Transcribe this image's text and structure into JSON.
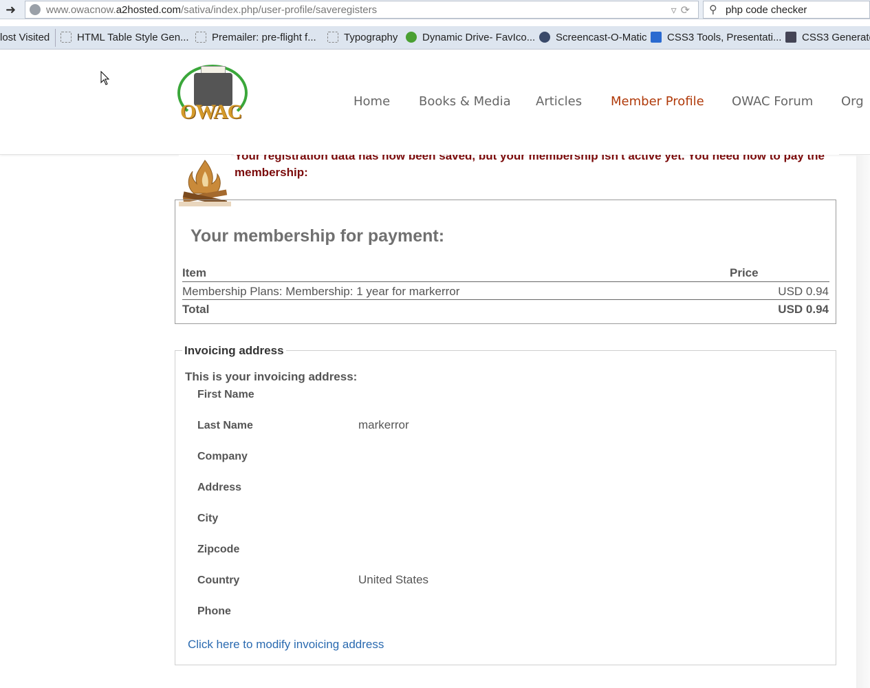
{
  "browser": {
    "url_prefix": "www.owacnow.",
    "url_host": "a2hosted.com",
    "url_path": "/sativa/index.php/user-profile/saveregisters",
    "search_value": "php code checker"
  },
  "bookmarks": [
    "lost Visited",
    "HTML Table Style Gen...",
    "Premailer: pre-flight f...",
    "Typography",
    "Dynamic Drive- FavIco...",
    "Screencast-O-Matic",
    "CSS3 Tools, Presentati...",
    "CSS3 Generato"
  ],
  "site": {
    "logo_text": "OWAC",
    "nav": [
      "Home",
      "Books & Media",
      "Articles",
      "Member Profile",
      "OWAC Forum",
      "Org"
    ],
    "active_nav": "Member Profile"
  },
  "notice": {
    "message": "Your registration data has now been saved, but your membership isn't active yet. You need now to pay the membership:"
  },
  "payment": {
    "title": "Your membership for payment:",
    "col_item": "Item",
    "col_price": "Price",
    "item": "Membership Plans: Membership: 1 year for markerror",
    "price": "USD 0.94",
    "total_label": "Total",
    "total_value": "USD 0.94"
  },
  "invoice": {
    "legend": "Invoicing address",
    "intro": "This is your invoicing address:",
    "fields": [
      {
        "label": "First Name",
        "value": ""
      },
      {
        "label": "Last Name",
        "value": "markerror"
      },
      {
        "label": "Company",
        "value": ""
      },
      {
        "label": "Address",
        "value": ""
      },
      {
        "label": "City",
        "value": ""
      },
      {
        "label": "Zipcode",
        "value": ""
      },
      {
        "label": "Country",
        "value": "United States"
      },
      {
        "label": "Phone",
        "value": ""
      }
    ],
    "modify_link": "Click here to modify invoicing address"
  }
}
